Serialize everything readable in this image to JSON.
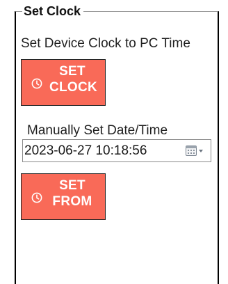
{
  "panel": {
    "legend": "Set Clock",
    "subtitle": "Set Device Clock to PC Time"
  },
  "set_clock_button": {
    "line1": "SET",
    "line2": "CLOCK",
    "icon": "clock-icon"
  },
  "manual": {
    "label": "Manually Set Date/Time",
    "value": "2023-06-27 10:18:56",
    "picker_icon": "calendar-dropdown-icon"
  },
  "set_from_button": {
    "line1": "SET",
    "line2": "FROM",
    "icon": "clock-icon"
  },
  "colors": {
    "button_bg": "#f96a58",
    "button_text": "#ffffff",
    "border": "#000000"
  }
}
